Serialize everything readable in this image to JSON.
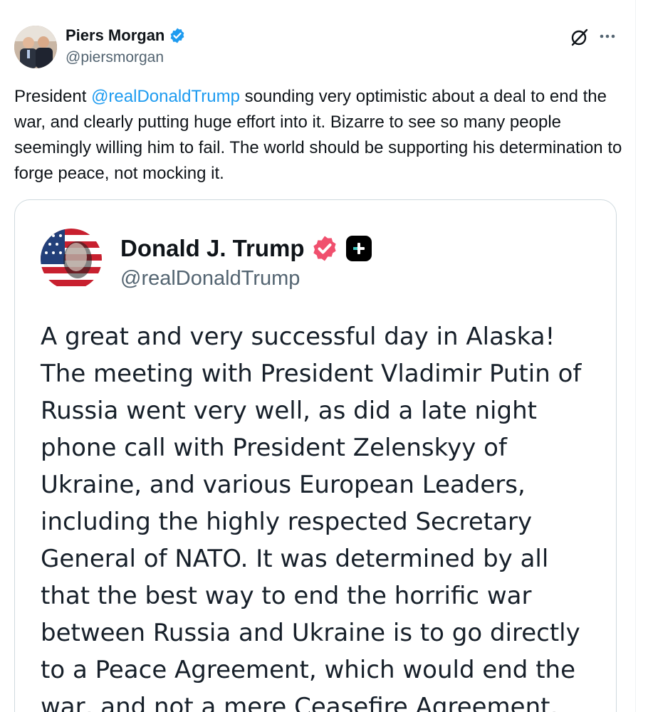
{
  "tweet": {
    "author": {
      "name": "Piers Morgan",
      "handle": "@piersmorgan",
      "verified_color": "#1d9bf0"
    },
    "text_before": "President ",
    "mention": "@realDonaldTrump",
    "text_after": " sounding very optimistic about a deal to end the war, and clearly putting huge effort into it. Bizarre to see so many people seemingly willing him to fail. The world should be supporting his determination to forge peace, not mocking it.",
    "icons": [
      "grok-icon",
      "more-options-icon"
    ]
  },
  "quoted": {
    "author": {
      "name": "Donald J. Trump",
      "handle": "@realDonaldTrump",
      "badge_color": "#f0506e"
    },
    "text": "A great and very successful day in Alaska! The meeting with President Vladimir Putin of Russia went very well, as did a late night phone call with President Zelenskyy of Ukraine, and various European Leaders, including the highly respected Secretary General of NATO. It was determined by all that the best way to end the horrific war between Russia and Ukraine is to go directly to a Peace Agreement, which would end the war, and not a mere Ceasefire Agreement,"
  },
  "colors": {
    "link": "#1d9bf0",
    "secondary_text": "#536471",
    "border": "#cfd9de"
  }
}
